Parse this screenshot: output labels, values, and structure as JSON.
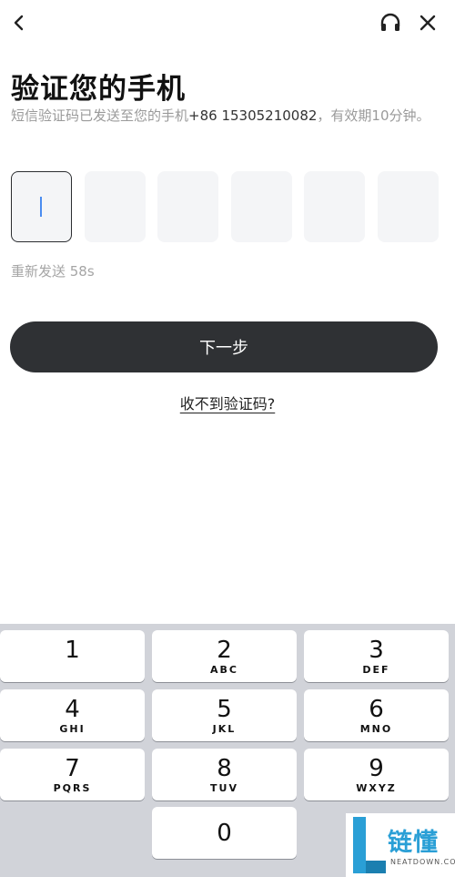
{
  "header": {
    "title": "验证您的手机",
    "subtitle_prefix": "短信验证码已发送至您的手机",
    "phone": "+86 15305210082",
    "subtitle_suffix": "，有效期10分钟。"
  },
  "code": {
    "length": 6,
    "values": [
      "",
      "",
      "",
      "",
      "",
      ""
    ],
    "active_index": 0
  },
  "resend_text": "重新发送 58s",
  "next_button": "下一步",
  "help_link": "收不到验证码?",
  "keyboard": {
    "keys": [
      {
        "num": "1",
        "letters": ""
      },
      {
        "num": "2",
        "letters": "ABC"
      },
      {
        "num": "3",
        "letters": "DEF"
      },
      {
        "num": "4",
        "letters": "GHI"
      },
      {
        "num": "5",
        "letters": "JKL"
      },
      {
        "num": "6",
        "letters": "MNO"
      },
      {
        "num": "7",
        "letters": "PQRS"
      },
      {
        "num": "8",
        "letters": "TUV"
      },
      {
        "num": "9",
        "letters": "WXYZ"
      },
      {
        "num": "0",
        "letters": ""
      }
    ]
  },
  "watermark": {
    "text": "链懂",
    "sub": "NEATDOWN.COM"
  },
  "colors": {
    "accent_button": "#2f3134",
    "caret": "#4a8cf0",
    "keyboard_bg": "#d1d3d9",
    "watermark": "#2a9fd6"
  }
}
